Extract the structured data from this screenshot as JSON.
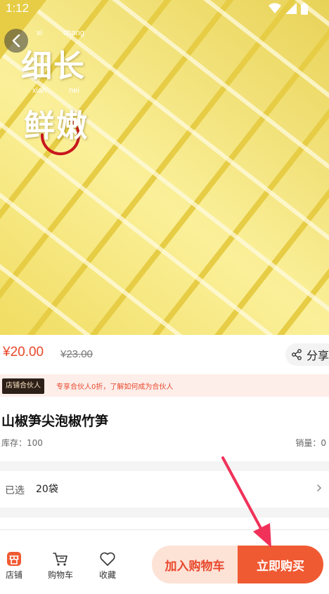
{
  "status_bar": {
    "time": "1:12"
  },
  "hero": {
    "pinyin": [
      "xi",
      "chang",
      "xian",
      "nei"
    ],
    "line1": "细长",
    "line2": "鲜嫩"
  },
  "price": {
    "current": "¥20.00",
    "original": "¥23.00",
    "share_label": "分享"
  },
  "partner": {
    "tag": "店铺合伙人",
    "text": "专享合伙人0折，了解如何成为合伙人"
  },
  "product": {
    "title": "山椒笋尖泡椒竹笋",
    "stock": "库存：100",
    "sales": "销量：0"
  },
  "selection": {
    "label": "已选",
    "value": "20袋"
  },
  "bottom_nav": {
    "shop": "店铺",
    "cart": "购物车",
    "favorite": "收藏"
  },
  "actions": {
    "add_to_cart": "加入购物车",
    "buy_now": "立即购买"
  },
  "colors": {
    "accent": "#f05a33",
    "price": "#e8482c",
    "cart_bg": "#fde2d6"
  }
}
